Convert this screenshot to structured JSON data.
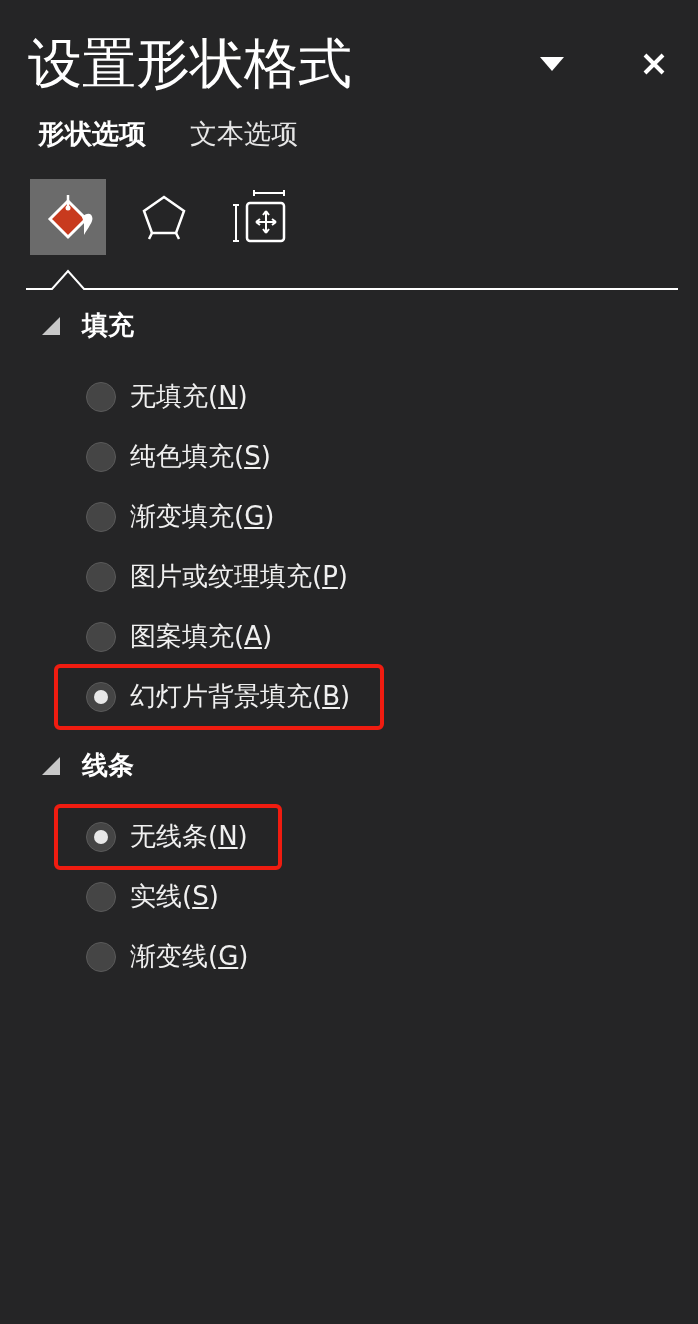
{
  "pane": {
    "title": "设置形状格式"
  },
  "tabs": [
    {
      "label": "形状选项",
      "selected": true
    },
    {
      "label": "文本选项",
      "selected": false
    }
  ],
  "icon_tabs": [
    {
      "kind": "fill",
      "selected": true
    },
    {
      "kind": "effects",
      "selected": false
    },
    {
      "kind": "size",
      "selected": false
    }
  ],
  "sections": [
    {
      "title": "填充",
      "expanded": true,
      "options": [
        {
          "text": "无填充(",
          "accelerator": "N",
          "after": ")",
          "selected": false,
          "highlighted": false
        },
        {
          "text": "纯色填充(",
          "accelerator": "S",
          "after": ")",
          "selected": false,
          "highlighted": false
        },
        {
          "text": "渐变填充(",
          "accelerator": "G",
          "after": ")",
          "selected": false,
          "highlighted": false
        },
        {
          "text": "图片或纹理填充(",
          "accelerator": "P",
          "after": ")",
          "selected": false,
          "highlighted": false
        },
        {
          "text": "图案填充(",
          "accelerator": "A",
          "after": ")",
          "selected": false,
          "highlighted": false
        },
        {
          "text": "幻灯片背景填充(",
          "accelerator": "B",
          "after": ")",
          "selected": true,
          "highlighted": true
        }
      ]
    },
    {
      "title": "线条",
      "expanded": true,
      "options": [
        {
          "text": "无线条(",
          "accelerator": "N",
          "after": ")",
          "selected": true,
          "highlighted": true
        },
        {
          "text": "实线(",
          "accelerator": "S",
          "after": ")",
          "selected": false,
          "highlighted": false
        },
        {
          "text": "渐变线(",
          "accelerator": "G",
          "after": ")",
          "selected": false,
          "highlighted": false
        }
      ]
    }
  ]
}
